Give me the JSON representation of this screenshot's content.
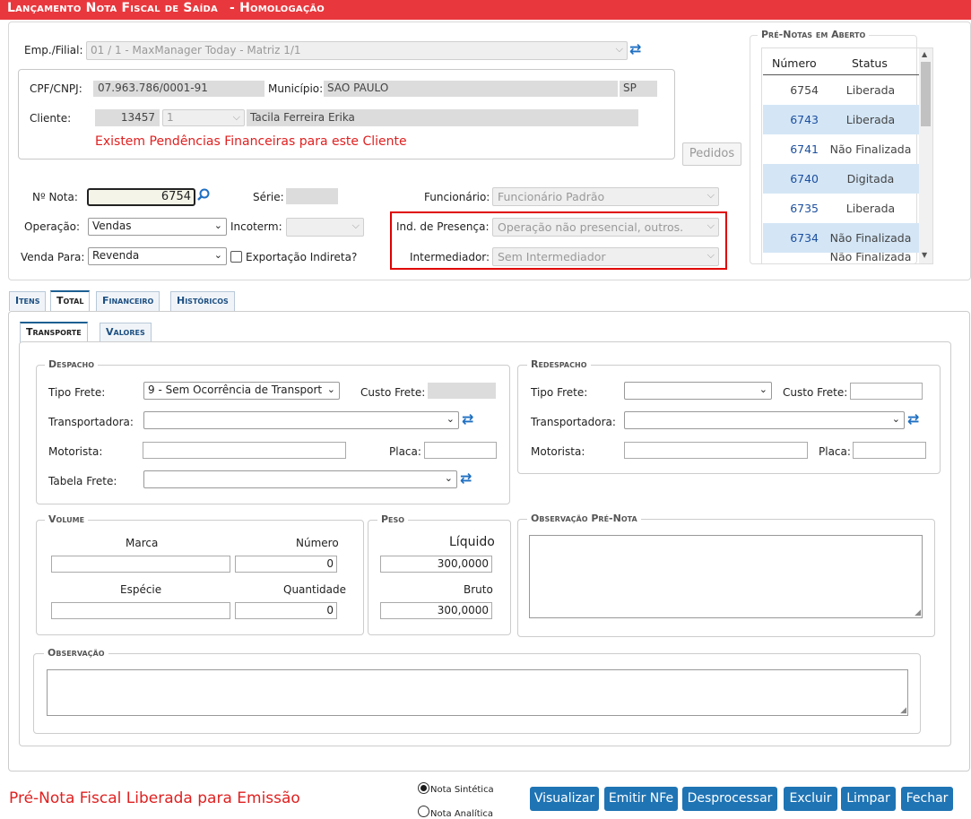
{
  "title": "Lançamento Nota Fiscal de Saída",
  "env": "- Homologação",
  "emp": {
    "label": "Emp./Filial:",
    "value": "01 / 1 - MaxManager Today - Matriz 1/1"
  },
  "client_box": {
    "cnpj_label": "CPF/CNPJ:",
    "cnpj": "07.963.786/0001-91",
    "mun_label": "Município:",
    "municipio": "SAO PAULO",
    "uf": "SP",
    "cliente_label": "Cliente:",
    "cliente_code": "13457",
    "cliente_loja": "1",
    "cliente_name": "Tacila Ferreira Erika",
    "warning": "Existem Pendências Financeiras para este Cliente"
  },
  "pedidos_label": "Pedidos",
  "nota": {
    "label": "Nº Nota:",
    "value": "6754"
  },
  "serie_label": "Série:",
  "funcionario": {
    "label": "Funcionário:",
    "value": "Funcionário Padrão"
  },
  "operacao": {
    "label": "Operação:",
    "value": "Vendas"
  },
  "incoterm_label": "Incoterm:",
  "presenca": {
    "label": "Ind. de Presença:",
    "value": "Operação não presencial, outros."
  },
  "intermediador": {
    "label": "Intermediador:",
    "value": "Sem Intermediador"
  },
  "venda_para": {
    "label": "Venda Para:",
    "value": "Revenda"
  },
  "exportacao_label": "Exportação Indireta?",
  "prenotas": {
    "legend": "Pré-Notas em Aberto",
    "col_numero": "Número",
    "col_status": "Status",
    "rows": [
      {
        "numero": "6754",
        "status": "Liberada"
      },
      {
        "numero": "6743",
        "status": "Liberada"
      },
      {
        "numero": "6741",
        "status": "Não Finalizada"
      },
      {
        "numero": "6740",
        "status": "Digitada"
      },
      {
        "numero": "6735",
        "status": "Liberada"
      },
      {
        "numero": "6734",
        "status": "Não Finalizada"
      },
      {
        "numero": "",
        "status": "Não Finalizada"
      }
    ]
  },
  "tabs": [
    "Itens",
    "Total",
    "Financeiro",
    "Históricos"
  ],
  "subtabs": [
    "Transporte",
    "Valores"
  ],
  "despacho": {
    "legend": "Despacho",
    "tipo_frete_label": "Tipo Frete:",
    "tipo_frete": "9 - Sem Ocorrência de Transport",
    "custo_frete_label": "Custo Frete:",
    "transportadora_label": "Transportadora:",
    "motorista_label": "Motorista:",
    "placa_label": "Placa:",
    "tabela_frete_label": "Tabela Frete:"
  },
  "redespacho": {
    "legend": "Redespacho",
    "tipo_frete_label": "Tipo Frete:",
    "custo_frete_label": "Custo Frete:",
    "transportadora_label": "Transportadora:",
    "motorista_label": "Motorista:",
    "placa_label": "Placa:"
  },
  "volume": {
    "legend": "Volume",
    "marca_label": "Marca",
    "numero_label": "Número",
    "numero": "0",
    "especie_label": "Espécie",
    "quantidade_label": "Quantidade",
    "quantidade": "0"
  },
  "peso": {
    "legend": "Peso",
    "liquido_label": "Líquido",
    "liquido": "300,0000",
    "bruto_label": "Bruto",
    "bruto": "300,0000"
  },
  "obs_prenota_legend": "Observação Pré-Nota",
  "obs_legend": "Observação",
  "status_msg": "Pré-Nota Fiscal Liberada para Emissão",
  "radio_sintetica": "Nota Sintética",
  "radio_analitica": "Nota Analítica",
  "buttons": {
    "visualizar": "Visualizar",
    "emitir": "Emitir NFe",
    "desprocessar": "Desprocessar",
    "excluir": "Excluir",
    "limpar": "Limpar",
    "fechar": "Fechar"
  },
  "colors": {
    "title_bg": "#e8383d",
    "button": "#1f74b4",
    "warning": "#e02020",
    "row_highlight": "#d4e6f6",
    "highlight_border": "#e00000"
  }
}
